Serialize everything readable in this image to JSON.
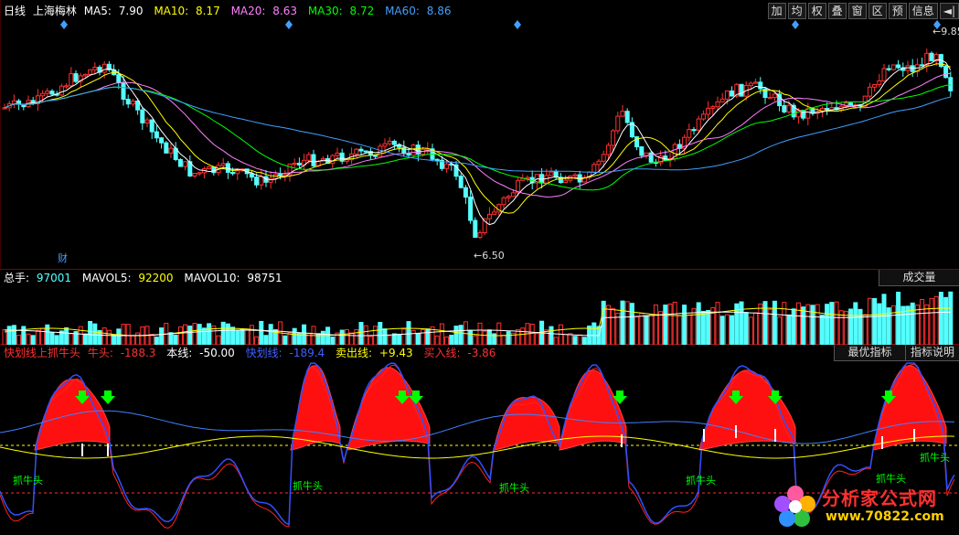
{
  "price_panel": {
    "period": "日线",
    "stock_name": "上海梅林",
    "ma": [
      {
        "label": "MA5:",
        "value": "7.90",
        "color": "#ffffff"
      },
      {
        "label": "MA10:",
        "value": "8.17",
        "color": "#ffff00"
      },
      {
        "label": "MA20:",
        "value": "8.63",
        "color": "#ff80ff"
      },
      {
        "label": "MA30:",
        "value": "8.72",
        "color": "#00ff00"
      },
      {
        "label": "MA60:",
        "value": "8.86",
        "color": "#40a0ff"
      }
    ],
    "high_label": "9.85",
    "low_label": "6.50",
    "finance_marker": "财"
  },
  "toolbar": [
    "加",
    "均",
    "权",
    "叠",
    "窗",
    "区",
    "预",
    "信息",
    "◄|"
  ],
  "volume_panel": {
    "total_label": "总手:",
    "total_value": "97001",
    "mavol5_label": "MAVOL5:",
    "mavol5_value": "92200",
    "mavol10_label": "MAVOL10:",
    "mavol10_value": "98751",
    "tab_label": "成交量"
  },
  "indicator_panel": {
    "name": "快划线上抓牛头",
    "fields": [
      {
        "label": "牛头:",
        "value": "-188.3",
        "color": "#ff3030"
      },
      {
        "label": "本线:",
        "value": "-50.00",
        "color": "#ffffff"
      },
      {
        "label": "快划线:",
        "value": "-189.4",
        "color": "#4060ff"
      },
      {
        "label": "卖出线:",
        "value": "+9.43",
        "color": "#ffff00"
      },
      {
        "label": "买入线:",
        "value": "-3.86",
        "color": "#ff3030"
      }
    ],
    "tab_best": "最优指标",
    "tab_help": "指标说明",
    "signal_label": "抓牛头"
  },
  "watermark": {
    "title": "分析家公式网",
    "url": "www.70822.com"
  },
  "colors": {
    "up": "#ff3030",
    "down": "#54ffff",
    "border": "#800000",
    "signal": "#00ff00"
  }
}
